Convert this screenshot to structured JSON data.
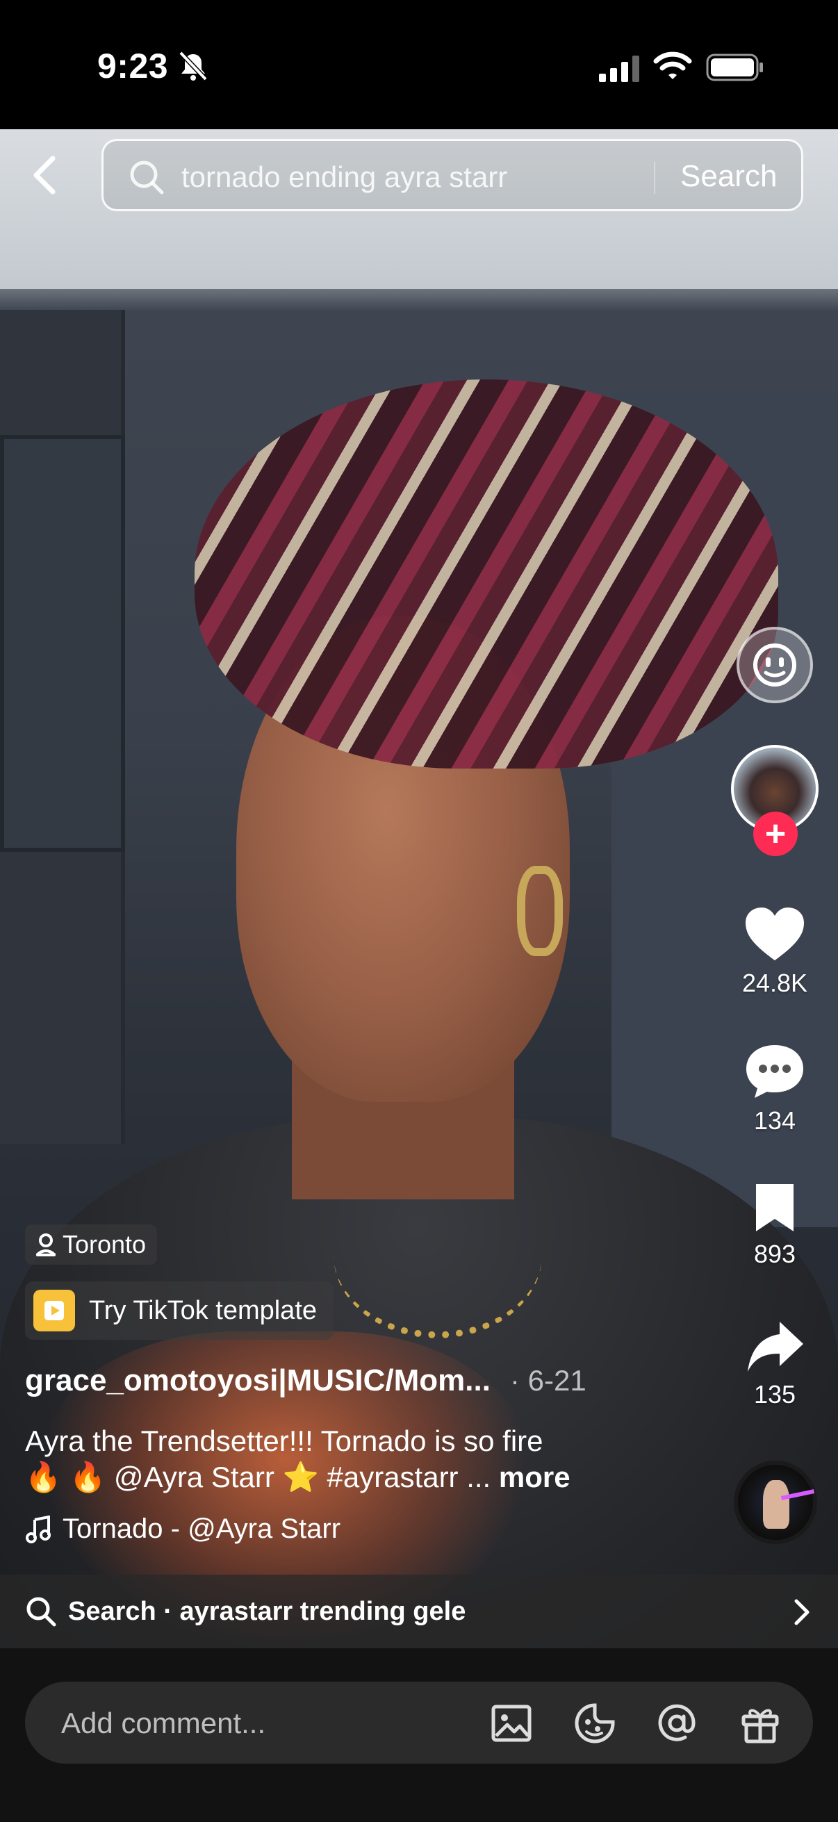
{
  "status_bar": {
    "time": "9:23"
  },
  "search": {
    "query": "tornado ending ayra starr",
    "submit_label": "Search"
  },
  "right_rail": {
    "likes": "24.8K",
    "comments": "134",
    "saves": "893",
    "shares": "135"
  },
  "post": {
    "location": "Toronto",
    "template_label": "Try TikTok template",
    "author": "grace_omotoyosi|MUSIC/Mom...",
    "date": "· 6-21",
    "caption_line1": "Ayra the Trendsetter!!! Tornado is so fire",
    "caption_line2": "🔥 🔥 @Ayra Starr ⭐ #ayrastarr ...",
    "caption_more": "more",
    "music": "Tornado - @Ayra Starr"
  },
  "related_search": {
    "label": "Search · ayrastarr trending gele"
  },
  "comment_bar": {
    "placeholder": "Add comment..."
  },
  "colors": {
    "accent": "#fe2c55",
    "template": "#f7c23a"
  }
}
